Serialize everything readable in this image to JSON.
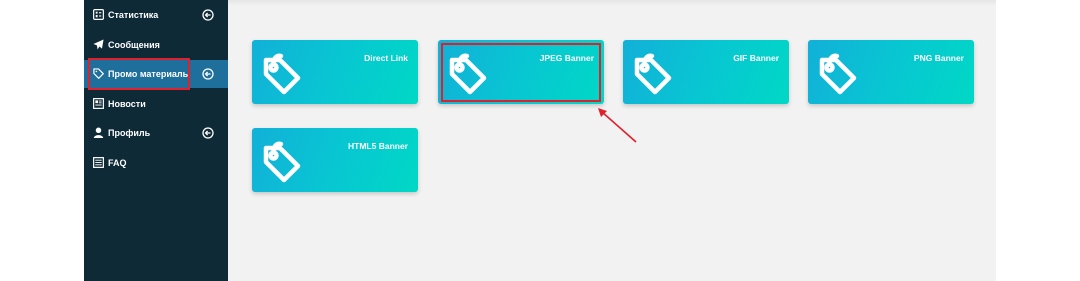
{
  "colors": {
    "sidebar_bg": "#0f2a37",
    "sidebar_active": "#1f6f9c",
    "content_bg": "#f2f2f2",
    "card_gradient_start": "#12b0d8",
    "card_gradient_end": "#00d8c6",
    "highlight": "#e0202c"
  },
  "sidebar": {
    "items": [
      {
        "label": "Статистика",
        "icon": "chart-icon",
        "expandable": true
      },
      {
        "label": "Сообщения",
        "icon": "paper-plane-icon",
        "expandable": false
      },
      {
        "label": "Промо материалы",
        "icon": "tag-icon",
        "expandable": true,
        "active": true
      },
      {
        "label": "Новости",
        "icon": "newspaper-icon",
        "expandable": false
      },
      {
        "label": "Профиль",
        "icon": "user-icon",
        "expandable": true
      },
      {
        "label": "FAQ",
        "icon": "list-icon",
        "expandable": false
      }
    ]
  },
  "main": {
    "cards": [
      {
        "title": "Direct Link",
        "icon": "tag-icon"
      },
      {
        "title": "JPEG Banner",
        "icon": "tag-icon",
        "highlighted": true
      },
      {
        "title": "GIF Banner",
        "icon": "tag-icon"
      },
      {
        "title": "PNG Banner",
        "icon": "tag-icon"
      },
      {
        "title": "HTML5 Banner",
        "icon": "tag-icon"
      }
    ]
  }
}
